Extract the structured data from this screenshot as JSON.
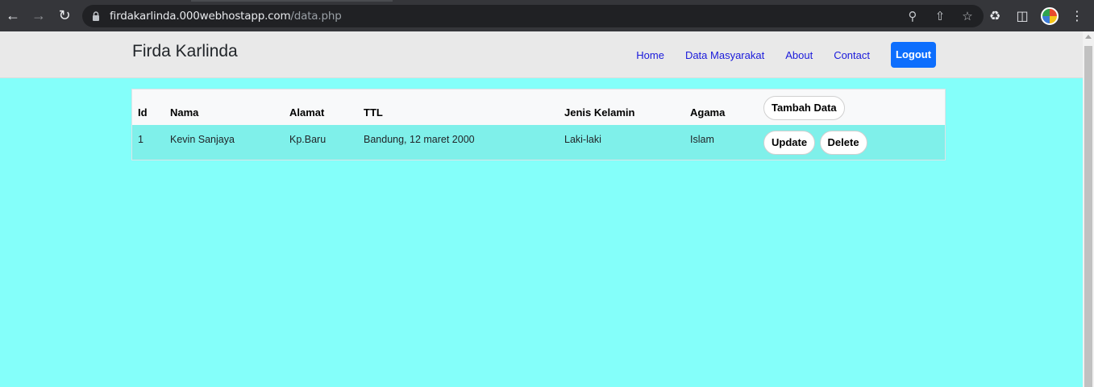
{
  "browser": {
    "url_host": "firdakarlinda.000webhostapp.com",
    "url_path": "/data.php"
  },
  "navbar": {
    "brand": "Firda Karlinda",
    "links": [
      "Home",
      "Data Masyarakat",
      "About",
      "Contact"
    ],
    "logout_label": "Logout",
    "accent_color": "#0d6efd"
  },
  "table": {
    "headers": [
      "Id",
      "Nama",
      "Alamat",
      "TTL",
      "Jenis Kelamin",
      "Agama"
    ],
    "add_label": "Tambah Data",
    "rows": [
      {
        "id": "1",
        "nama": "Kevin Sanjaya",
        "alamat": "Kp.Baru",
        "ttl": "Bandung, 12 maret 2000",
        "jenis_kelamin": "Laki-laki",
        "agama": "Islam",
        "update_label": "Update",
        "delete_label": "Delete"
      }
    ]
  },
  "colors": {
    "page_background": "#84fffa",
    "row_background": "#7ff0ea"
  }
}
